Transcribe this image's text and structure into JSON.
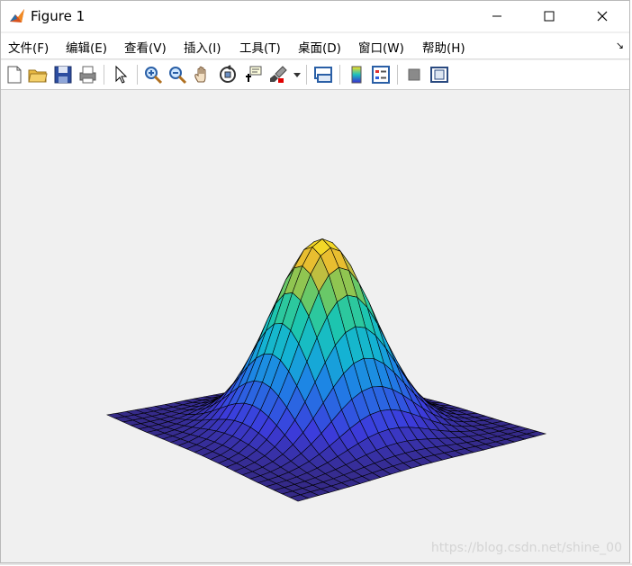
{
  "window": {
    "title": "Figure 1",
    "controls": {
      "minimize": "minimize",
      "maximize": "maximize",
      "close": "close"
    }
  },
  "menubar": {
    "items": [
      "文件(F)",
      "编辑(E)",
      "查看(V)",
      "插入(I)",
      "工具(T)",
      "桌面(D)",
      "窗口(W)",
      "帮助(H)"
    ],
    "overflow_glyph": "↘"
  },
  "toolbar": {
    "buttons": [
      "new-figure",
      "open",
      "save",
      "print",
      "select",
      "zoom-in",
      "zoom-out",
      "pan",
      "rotate-3d",
      "data-cursor",
      "brush",
      "link-plot",
      "colorbar",
      "legend",
      "hide-plot-tools",
      "show-plot-tools"
    ]
  },
  "plot": {
    "type": "surface",
    "colormap": "parula",
    "watermark": "https://blog.csdn.net/shine_00"
  },
  "colors": {
    "title_bg": "#ffffff",
    "figure_bg": "#f0f0f0",
    "mesh_edges": "#000000"
  }
}
